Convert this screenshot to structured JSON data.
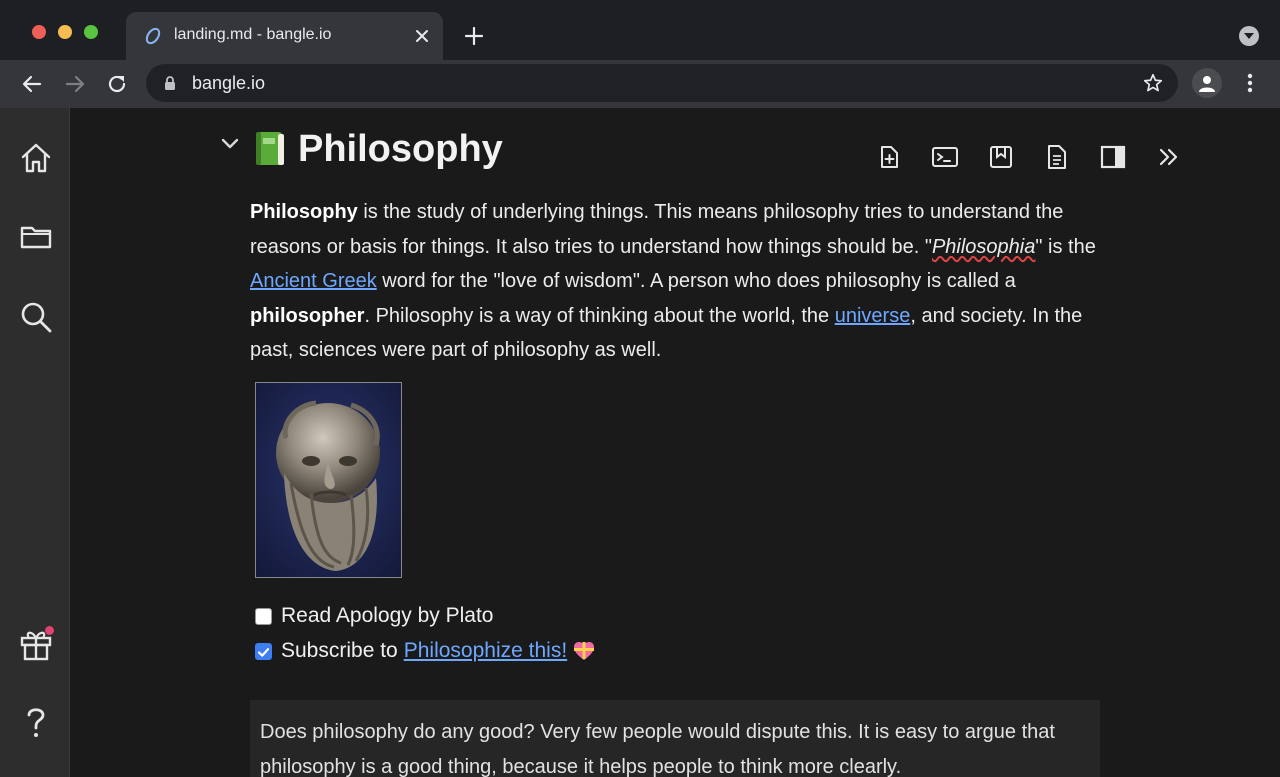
{
  "browser": {
    "tab_title": "landing.md - bangle.io",
    "url": "bangle.io"
  },
  "document": {
    "title": "Philosophy",
    "title_emoji": "green-book",
    "paragraph": {
      "b1": "Philosophy",
      "t1": " is the study of underlying things. This means philosophy tries to understand the reasons or basis for things. It also tries to understand how things should be. \"",
      "i1": "Philosophia",
      "t2": "\" is the ",
      "link1": "Ancient Greek",
      "t3": " word for the \"love of wisdom\". A person who does philosophy is called a ",
      "b2": "philosopher",
      "t4": ".  Philosophy is a way of thinking about the world, the ",
      "link2": "universe",
      "t5": ", and society. In the past, sciences were part of philosophy as well."
    },
    "image_subject": "bust of Socrates",
    "todos": [
      {
        "checked": false,
        "text": "Read Apology by Plato"
      },
      {
        "checked": true,
        "text": "Subscribe to",
        "link": "Philosophize this!"
      }
    ],
    "quote": "Does philosophy do any good? Very few people would dispute this. It is easy to argue that philosophy is a good thing, because it helps people to think more clearly."
  },
  "sidebar_icons": [
    "home-icon",
    "folder-icon",
    "search-icon",
    "gift-icon",
    "help-icon"
  ],
  "toolbar_icons": [
    "new-file-icon",
    "terminal-icon",
    "bookmark-icon",
    "document-icon",
    "split-view-icon",
    "expand-icon"
  ],
  "colors": {
    "link": "#6ea8fe",
    "checkbox_checked": "#3d7ef2",
    "notification_dot": "#e2426f"
  }
}
